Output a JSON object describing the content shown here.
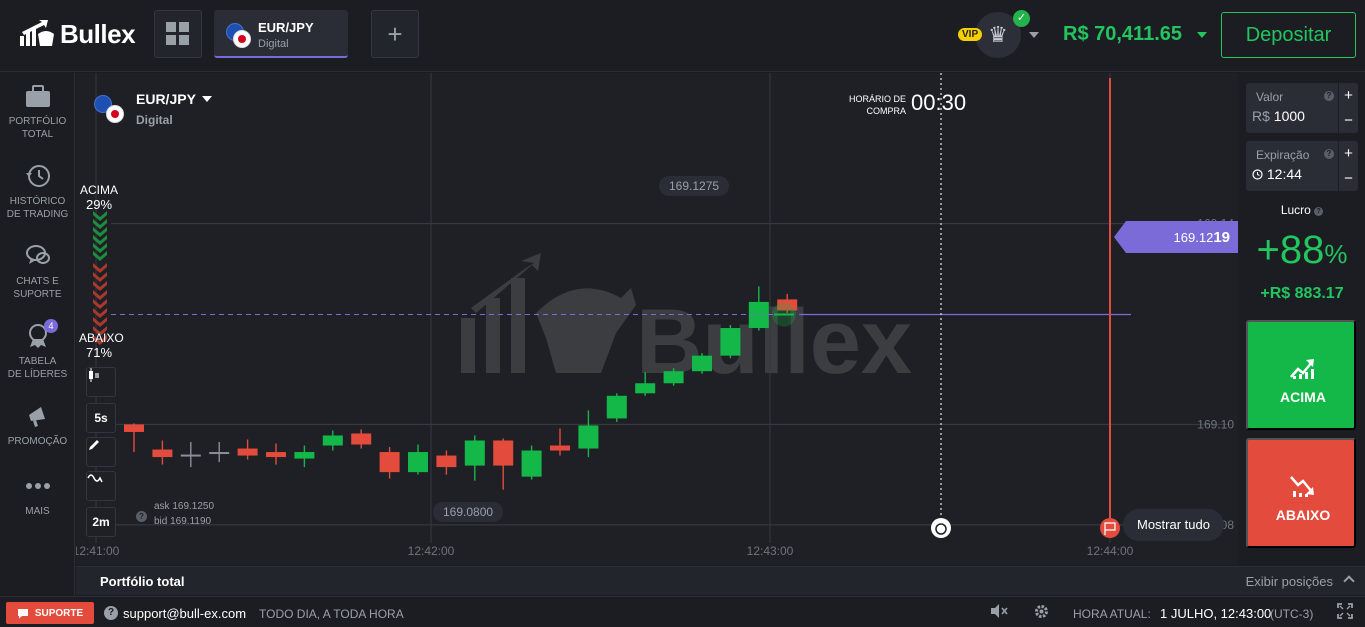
{
  "brand": {
    "name": "Bullex",
    "watermark": "Bullex"
  },
  "header": {
    "tab": {
      "asset": "EUR/JPY",
      "type": "Digital"
    },
    "add_symbol": "+",
    "vip": "VIP",
    "balance": "R$ 70,411.65",
    "deposit_label": "Depositar"
  },
  "sidebar": {
    "items": [
      {
        "label1": "PORTFÓLIO",
        "label2": "TOTAL",
        "icon": "briefcase-icon"
      },
      {
        "label1": "HISTÓRICO",
        "label2": "DE TRADING",
        "icon": "history-icon"
      },
      {
        "label1": "CHATS E",
        "label2": "SUPORTE",
        "icon": "chat-icon"
      },
      {
        "label1": "TABELA",
        "label2": "DE LÍDERES",
        "icon": "leaderboard-icon",
        "badge": "4"
      },
      {
        "label1": "PROMOÇÃO",
        "label2": "",
        "icon": "megaphone-icon"
      },
      {
        "label1": "MAIS",
        "label2": "",
        "icon": "more-icon"
      }
    ]
  },
  "chart": {
    "asset": "EUR/JPY",
    "asset_type": "Digital",
    "up_label": "ACIMA",
    "up_pct": "29%",
    "down_label": "ABAIXO",
    "down_pct": "71%",
    "tools": {
      "timeframe": "5s",
      "zoom": "2m"
    },
    "ask": "ask 169.1250",
    "bid": "bid 169.1190",
    "purchase_line1": "HORÁRIO DE",
    "purchase_line2": "COMPRA",
    "timer": "00:30",
    "current_price_prefix": "169.12",
    "current_price_suffix": "19",
    "high_label": "169.1275",
    "low_label": "169.0800",
    "show_all": "Mostrar tudo"
  },
  "chart_data": {
    "type": "candlestick",
    "y_ticks": [
      "169.14",
      "169.10",
      "169.08"
    ],
    "y_tick_values": [
      169.14,
      169.1,
      169.08
    ],
    "x_ticks": [
      "12:41:00",
      "12:42:00",
      "12:43:00",
      "12:44:00"
    ],
    "ylim": [
      169.072,
      169.17
    ],
    "current_price": 169.1219,
    "candles": [
      {
        "o": 169.0985,
        "c": 169.1,
        "h": 169.1002,
        "l": 169.0945,
        "up": false
      },
      {
        "o": 169.095,
        "c": 169.0935,
        "h": 169.0968,
        "l": 169.092,
        "up": false
      },
      {
        "o": 169.094,
        "c": 169.094,
        "h": 169.0965,
        "l": 169.0915,
        "up": null
      },
      {
        "o": 169.0945,
        "c": 169.0945,
        "h": 169.0965,
        "l": 169.0925,
        "up": null
      },
      {
        "o": 169.0952,
        "c": 169.0938,
        "h": 169.097,
        "l": 169.093,
        "up": false
      },
      {
        "o": 169.0945,
        "c": 169.0935,
        "h": 169.0962,
        "l": 169.092,
        "up": false
      },
      {
        "o": 169.0932,
        "c": 169.0945,
        "h": 169.0958,
        "l": 169.0915,
        "up": true
      },
      {
        "o": 169.0958,
        "c": 169.0978,
        "h": 169.0988,
        "l": 169.0948,
        "up": true
      },
      {
        "o": 169.0982,
        "c": 169.096,
        "h": 169.099,
        "l": 169.0952,
        "up": false
      },
      {
        "o": 169.0945,
        "c": 169.0905,
        "h": 169.0955,
        "l": 169.0892,
        "up": false
      },
      {
        "o": 169.0905,
        "c": 169.0945,
        "h": 169.096,
        "l": 169.09,
        "up": true
      },
      {
        "o": 169.0938,
        "c": 169.0915,
        "h": 169.0948,
        "l": 169.09,
        "up": false
      },
      {
        "o": 169.0918,
        "c": 169.0968,
        "h": 169.0978,
        "l": 169.0888,
        "up": true
      },
      {
        "o": 169.0968,
        "c": 169.0918,
        "h": 169.0972,
        "l": 169.087,
        "up": false
      },
      {
        "o": 169.0896,
        "c": 169.0948,
        "h": 169.0958,
        "l": 169.089,
        "up": true
      },
      {
        "o": 169.0958,
        "c": 169.0948,
        "h": 169.0992,
        "l": 169.0938,
        "up": false
      },
      {
        "o": 169.0952,
        "c": 169.0998,
        "h": 169.1028,
        "l": 169.0935,
        "up": true
      },
      {
        "o": 169.1012,
        "c": 169.1057,
        "h": 169.1062,
        "l": 169.1005,
        "up": true
      },
      {
        "o": 169.1062,
        "c": 169.1082,
        "h": 169.1104,
        "l": 169.1057,
        "up": true
      },
      {
        "o": 169.1082,
        "c": 169.1106,
        "h": 169.1112,
        "l": 169.1077,
        "up": true
      },
      {
        "o": 169.1106,
        "c": 169.1137,
        "h": 169.1142,
        "l": 169.1101,
        "up": true
      },
      {
        "o": 169.1137,
        "c": 169.1192,
        "h": 169.1198,
        "l": 169.1132,
        "up": true
      },
      {
        "o": 169.1192,
        "c": 169.1244,
        "h": 169.1275,
        "l": 169.1187,
        "up": true
      },
      {
        "o": 169.1249,
        "c": 169.1227,
        "h": 169.126,
        "l": 169.1222,
        "up": false
      }
    ]
  },
  "panel": {
    "valor_label": "Valor",
    "valor_currency": "R$",
    "valor_value": "1000",
    "expiracao_label": "Expiração",
    "expiracao_value": "12:44",
    "lucro_label": "Lucro",
    "lucro_pct": "+88",
    "lucro_pct_sign": "%",
    "lucro_value": "+R$ 883.17",
    "up_button": "ACIMA",
    "down_button": "ABAIXO",
    "plus": "+",
    "minus": "−",
    "help": "?"
  },
  "portfolio": {
    "title": "Portfólio total",
    "show_positions": "Exibir posições"
  },
  "footer": {
    "support": "SUPORTE",
    "email": "support@bull-ex.com",
    "availability": "TODO DIA, A TODA HORA",
    "time_label": "HORA ATUAL:",
    "time_value": "1 JULHO, 12:43:00",
    "timezone": "(UTC-3)"
  },
  "colors": {
    "up": "#14b849",
    "down": "#e34b3c",
    "accent": "#7b6bd9",
    "balance": "#22c55e"
  }
}
